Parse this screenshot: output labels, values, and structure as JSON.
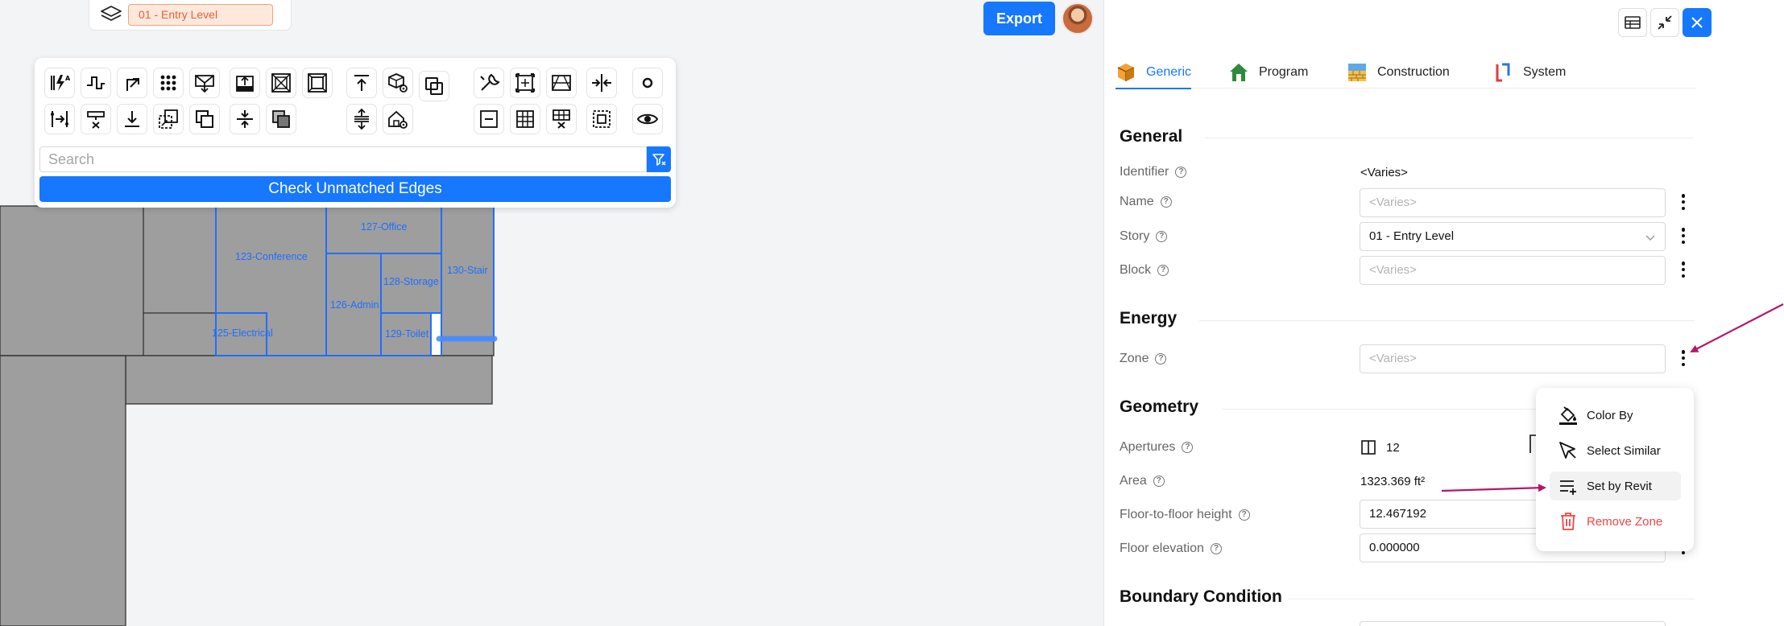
{
  "level_selector": {
    "current_level": "01 - Entry Level"
  },
  "header": {
    "export_label": "Export"
  },
  "colors": {
    "accent": "#1677ff",
    "room_outline": "#1f6fff",
    "room_fill": "#9e9e9e",
    "danger": "#ef4444",
    "annotation_arrow": "#b5166b",
    "level_badge": "#e8603a"
  },
  "toolbar": {
    "row1_icons": [
      "lightning-label-icon",
      "step-profile-icon",
      "corner-arrow-icon",
      "dot-grid-icon",
      "roof-slope-icon",
      "upload-box-icon",
      "crossed-box-icon",
      "inner-square-icon",
      "align-top-icon",
      "cube-gear-icon",
      "overlap-squares-icon",
      "wrench-icon",
      "resize-frame-icon",
      "perspective-icon",
      "merge-in-icon",
      "circle-icon"
    ],
    "row2_icons": [
      "split-edge-icon",
      "delete-beam-icon",
      "align-bottom-icon",
      "stacked-move-icon",
      "copy-squares-icon",
      "split-vertical-icon",
      "shaded-squares-icon",
      "spacer",
      "expand-vertical-icon",
      "house-gear-icon",
      "spacer",
      "minus-box-icon",
      "grid-icon",
      "delete-grid-icon",
      "select-region-icon",
      "eye-icon"
    ],
    "search_placeholder": "Search",
    "check_button_label": "Check Unmatched Edges"
  },
  "plan": {
    "rooms": [
      "123-Conference",
      "127-Office",
      "128-Storage",
      "130-Stair",
      "126-Admin",
      "125-Electrical",
      "129-Toilet"
    ]
  },
  "panel": {
    "tabs": [
      {
        "label": "Generic",
        "icon": "cube-icon",
        "active": true
      },
      {
        "label": "Program",
        "icon": "house-icon",
        "active": false
      },
      {
        "label": "Construction",
        "icon": "wall-icon",
        "active": false
      },
      {
        "label": "System",
        "icon": "duct-icon",
        "active": false
      }
    ],
    "general": {
      "title": "General",
      "identifier_label": "Identifier",
      "identifier_value": "<Varies>",
      "name_label": "Name",
      "name_placeholder": "<Varies>",
      "story_label": "Story",
      "story_value": "01 - Entry Level",
      "block_label": "Block",
      "block_placeholder": "<Varies>"
    },
    "energy": {
      "title": "Energy",
      "zone_label": "Zone",
      "zone_placeholder": "<Varies>"
    },
    "geometry": {
      "title": "Geometry",
      "apertures_label": "Apertures",
      "apertures_value": "12",
      "area_label": "Area",
      "area_value": "1323.369 ft²",
      "ftf_label": "Floor-to-floor height",
      "ftf_value": "12.467192",
      "elevation_label": "Floor elevation",
      "elevation_value": "0.000000"
    },
    "boundary": {
      "title": "Boundary Condition"
    }
  },
  "context_menu": {
    "items": [
      {
        "label": "Color By",
        "icon": "paint-bucket-icon"
      },
      {
        "label": "Select Similar",
        "icon": "select-cursor-icon"
      },
      {
        "label": "Set by Revit",
        "icon": "list-add-icon"
      },
      {
        "label": "Remove Zone",
        "icon": "trash-icon"
      }
    ]
  }
}
